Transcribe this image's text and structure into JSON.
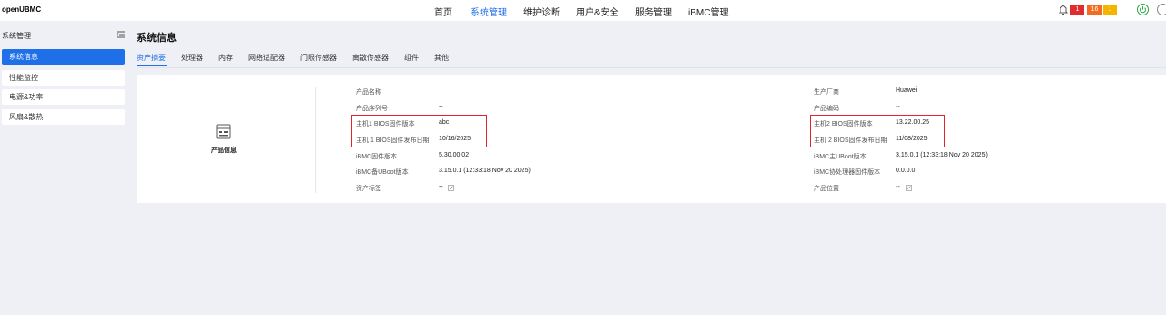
{
  "header": {
    "logo": "openUBMC",
    "nav": [
      "首页",
      "系统管理",
      "维护诊断",
      "用户&安全",
      "服务管理",
      "iBMC管理"
    ],
    "active_nav": "系统管理",
    "alerts": {
      "critical": "1",
      "major": "16",
      "minor": "1"
    },
    "colors": {
      "critical": "#e02c2c",
      "major": "#f26d21",
      "minor": "#f4b400",
      "accent": "#1e6fe8"
    }
  },
  "sidebar": {
    "title": "系统管理",
    "items": [
      {
        "label": "系统信息",
        "active": true
      },
      {
        "label": "性能监控"
      },
      {
        "label": "电源&功率"
      },
      {
        "label": "风扇&散热"
      }
    ]
  },
  "main": {
    "title": "系统信息",
    "tabs": [
      "资产摘要",
      "处理器",
      "内存",
      "网络适配器",
      "门限传感器",
      "离散传感器",
      "组件",
      "其他"
    ],
    "active_tab": "资产摘要",
    "product_label": "产品信息",
    "left": [
      {
        "label": "产品名称",
        "value": ""
      },
      {
        "label": "产品序列号",
        "value": "--"
      },
      {
        "label": "主机1 BIOS固件版本",
        "value": "abc"
      },
      {
        "label": "主机 1 BIOS固件发布日期",
        "value": "10/16/2025"
      },
      {
        "label": "iBMC固件版本",
        "value": "5.30.00.02"
      },
      {
        "label": "iBMC备UBoot版本",
        "value": "3.15.0.1 (12:33:18 Nov 20 2025)"
      },
      {
        "label": "资产标签",
        "value": "--"
      }
    ],
    "right": [
      {
        "label": "生产厂商",
        "value": "Huawei"
      },
      {
        "label": "产品编码",
        "value": "--"
      },
      {
        "label": "主机2 BIOS固件版本",
        "value": "13.22.00.25"
      },
      {
        "label": "主机 2 BIOS固件发布日期",
        "value": "11/08/2025"
      },
      {
        "label": "iBMC主UBoot版本",
        "value": "3.15.0.1 (12:33:18 Nov 20 2025)"
      },
      {
        "label": "iBMC协处理器固件版本",
        "value": "0.0.0.0"
      },
      {
        "label": "产品位置",
        "value": "--"
      }
    ]
  }
}
